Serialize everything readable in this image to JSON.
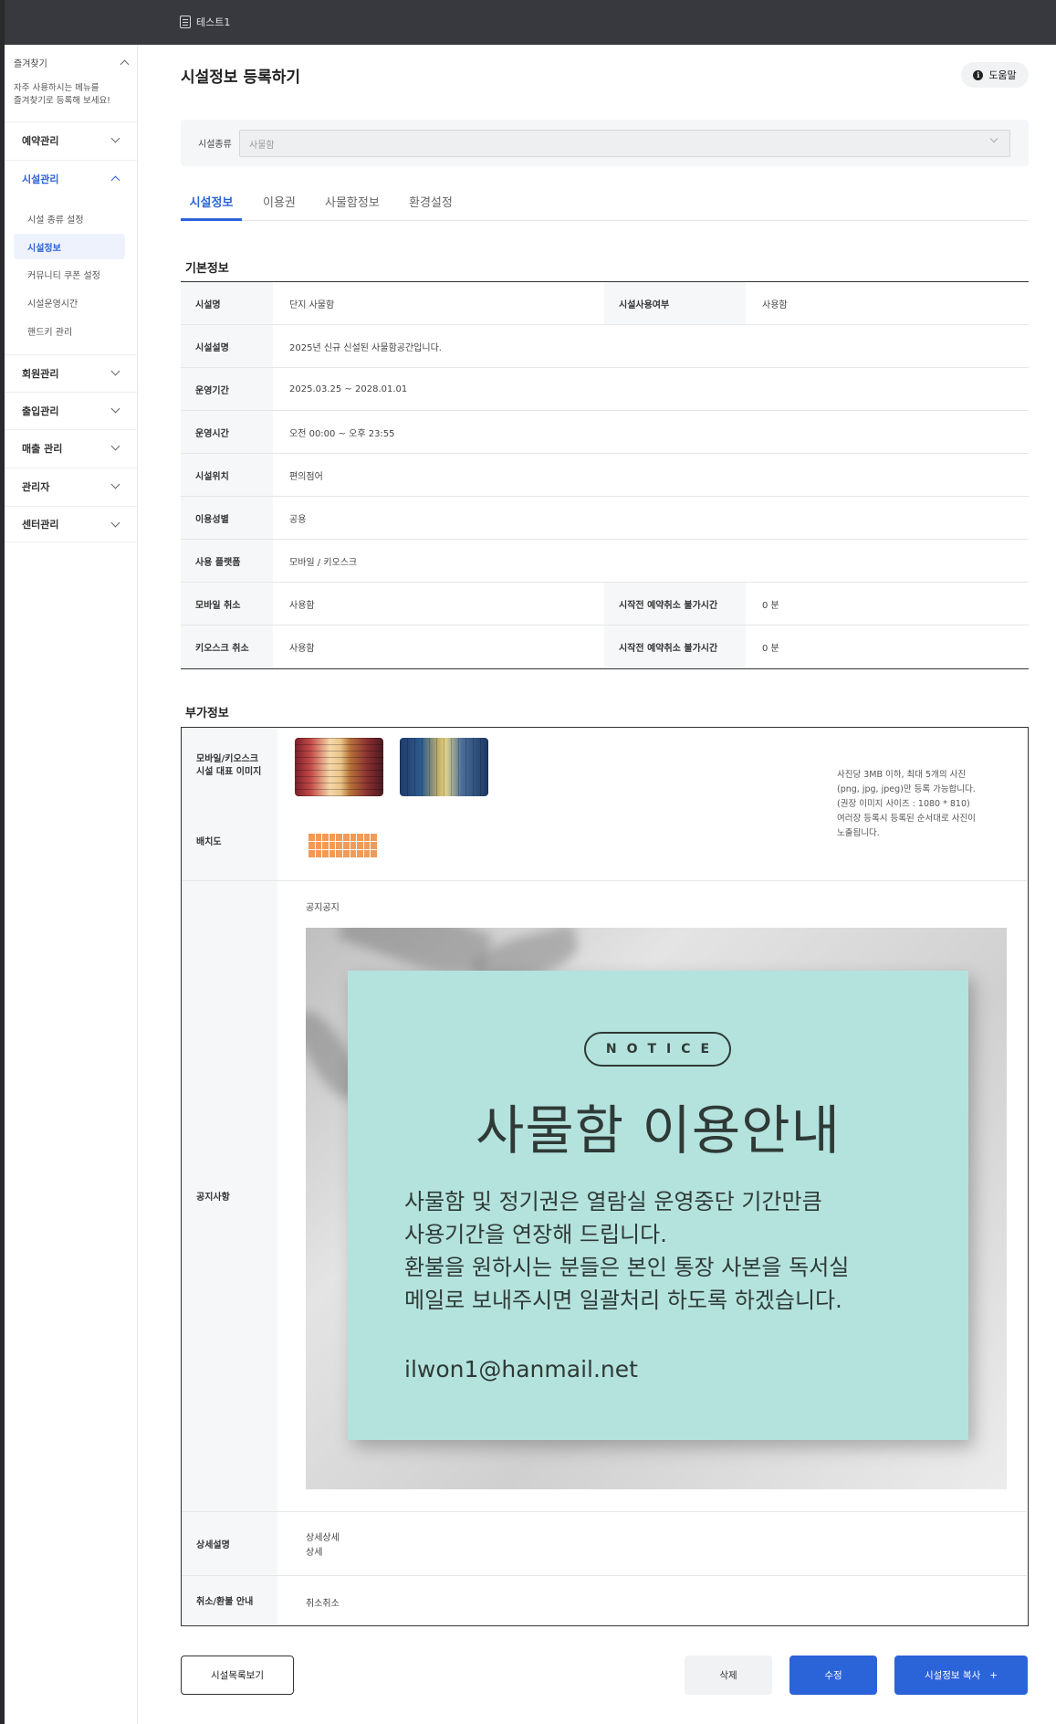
{
  "topbar": {
    "tab_title": "테스트1"
  },
  "sidebar": {
    "favorites": {
      "title": "즐겨찾기",
      "description": "자주 사용하시는 메뉴를\n즐겨찾기로 등록해 보세요!"
    },
    "menus": [
      {
        "label": "예약관리"
      },
      {
        "label": "시설관리"
      },
      {
        "label": "회원관리"
      },
      {
        "label": "출입관리"
      },
      {
        "label": "매출 관리"
      },
      {
        "label": "관리자"
      },
      {
        "label": "센터관리"
      }
    ],
    "submenu": [
      {
        "label": "시설 종류 설정"
      },
      {
        "label": "시설정보"
      },
      {
        "label": "커뮤니티 쿠폰 설정"
      },
      {
        "label": "시설운영시간"
      },
      {
        "label": "핸드키 관리"
      }
    ]
  },
  "header": {
    "title": "시설정보 등록하기",
    "help_label": "도움말"
  },
  "filter": {
    "label": "시설종류",
    "value": "사물함"
  },
  "tabs": [
    {
      "label": "시설정보"
    },
    {
      "label": "이용권"
    },
    {
      "label": "사물함정보"
    },
    {
      "label": "환경설정"
    }
  ],
  "basic": {
    "title": "기본정보",
    "facility_name": {
      "label": "시설명",
      "value": "단지 사물함"
    },
    "usage_status": {
      "label": "시설사용여부",
      "value": "사용함"
    },
    "description": {
      "label": "시설설명",
      "value": "2025년 신규 신설된 사물함공간입니다."
    },
    "period": {
      "label": "운영기간",
      "value": "2025.03.25 ~ 2028.01.01"
    },
    "hours": {
      "label": "운영시간",
      "value": "오전 00:00 ~ 오후 23:55"
    },
    "location": {
      "label": "시설위치",
      "value": "편의점어"
    },
    "gender": {
      "label": "이용성별",
      "value": "공용"
    },
    "platform": {
      "label": "사용 플랫폼",
      "value": "모바일 / 키오스크"
    },
    "mobile_cancel": {
      "label": "모바일 취소",
      "value": "사용함",
      "limit_label": "시작전 예약취소 불가시간",
      "limit_value": "0 분"
    },
    "kiosk_cancel": {
      "label": "키오스크 취소",
      "value": "사용함",
      "limit_label": "시작전 예약취소 불가시간",
      "limit_value": "0 분"
    }
  },
  "extra": {
    "title": "부가정보",
    "image_label": "모바일/키오스크\n시설 대표 이미지",
    "layout_label": "배치도",
    "image_note": "사진당 3MB 이하, 최대 5개의 사진\n(png, jpg, jpeg)만 등록 가능합니다.\n(권장 이미지 사이즈 : 1080 * 810)\n여러장 등록시 등록된 순서대로 사진이\n노출됩니다.",
    "notice_label": "공지사항",
    "notice_title": "공지공지",
    "notice_image": {
      "pill": "NOTICE",
      "heading": "사물함 이용안내",
      "body": "사물함  및 정기권은 열람실 운영중단 기간만큼\n사용기간을 연장해 드립니다.\n환불을 원하시는 분들은 본인 통장 사본을 독서실\n메일로 보내주시면 일괄처리 하도록 하겠습니다.",
      "email": "ilwon1@hanmail.net"
    },
    "detail_label": "상세설명",
    "detail_value": "상세상세\n상세",
    "refund_label": "취소/환불 안내",
    "refund_value": "취소취소"
  },
  "buttons": {
    "list": "시설목록보기",
    "delete": "삭제",
    "edit": "수정",
    "copy": "시설정보 복사",
    "copy_icon": "+"
  },
  "colors": {
    "accent": "#2b63d9",
    "topbar": "#37393e",
    "notice_card": "#b4e3de"
  }
}
